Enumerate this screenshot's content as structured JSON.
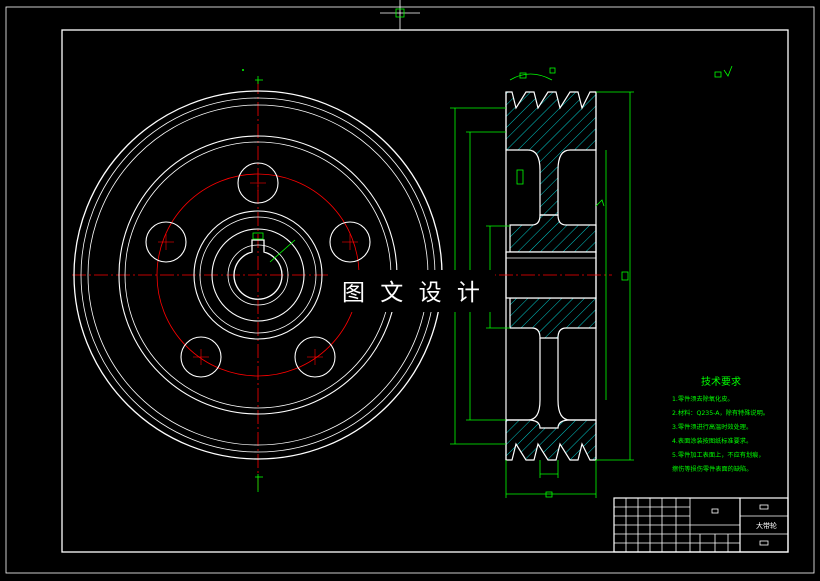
{
  "colors": {
    "background": "#000000",
    "outline": "#ffffff",
    "centerline": "#ff0000",
    "dimension": "#00ff00",
    "hatch": "#00c8c8"
  },
  "watermark": "图 文 设 计",
  "tech_requirements": {
    "title": "技术要求",
    "lines": [
      "1.零件须去除氧化皮。",
      "2.材料：Q235-A，除有特殊说明。",
      "3.零件须进行高温时效处理。",
      "4.表面涂装按图纸标准要求。",
      "5.零件加工表面上，不应有划痕，",
      "擦伤等损伤零件表面的缺陷。"
    ]
  },
  "title_block": {
    "part_name": "大带轮"
  }
}
